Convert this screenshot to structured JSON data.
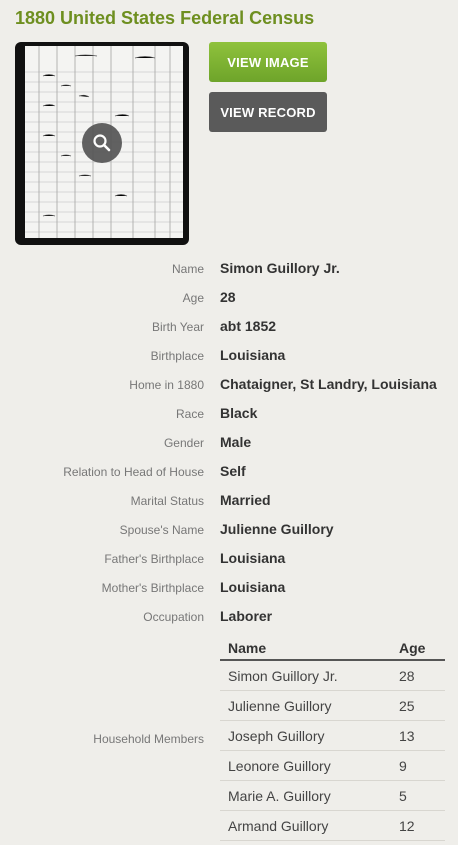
{
  "title": "1880 United States Federal Census",
  "buttons": {
    "view_image": "VIEW IMAGE",
    "view_record": "VIEW RECORD"
  },
  "icons": {
    "zoom": "magnifier-icon"
  },
  "fields": [
    {
      "label": "Name",
      "value": "Simon Guillory Jr."
    },
    {
      "label": "Age",
      "value": "28"
    },
    {
      "label": "Birth Year",
      "value": "abt 1852"
    },
    {
      "label": "Birthplace",
      "value": "Louisiana"
    },
    {
      "label": "Home in 1880",
      "value": "Chataigner, St Landry, Louisiana"
    },
    {
      "label": "Race",
      "value": "Black"
    },
    {
      "label": "Gender",
      "value": "Male"
    },
    {
      "label": "Relation to Head of House",
      "value": "Self"
    },
    {
      "label": "Marital Status",
      "value": "Married"
    },
    {
      "label": "Spouse's Name",
      "value": "Julienne Guillory"
    },
    {
      "label": "Father's Birthplace",
      "value": "Louisiana"
    },
    {
      "label": "Mother's Birthplace",
      "value": "Louisiana"
    },
    {
      "label": "Occupation",
      "value": "Laborer"
    }
  ],
  "household": {
    "label": "Household Members",
    "columns": [
      "Name",
      "Age"
    ],
    "rows": [
      [
        "Simon Guillory Jr.",
        "28"
      ],
      [
        "Julienne Guillory",
        "25"
      ],
      [
        "Joseph Guillory",
        "13"
      ],
      [
        "Leonore Guillory",
        "9"
      ],
      [
        "Marie A. Guillory",
        "5"
      ],
      [
        "Armand Guillory",
        "12"
      ]
    ]
  },
  "colors": {
    "title": "#6e8f20",
    "view_image_bg": "#7cb332",
    "view_record_bg": "#5a5a5a",
    "page_bg": "#efeeea"
  }
}
